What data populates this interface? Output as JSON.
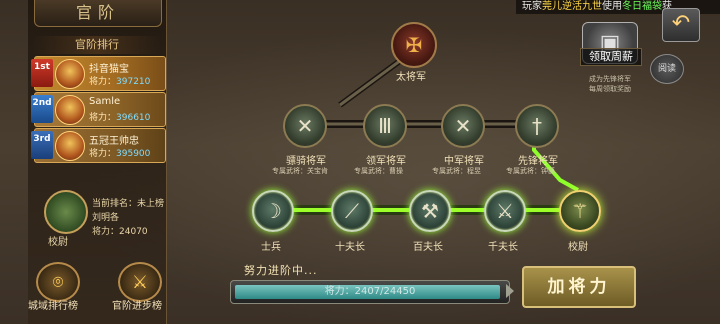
{
  "title": "官阶",
  "ticker": {
    "prefix": "玩家",
    "player": "莞儿逆活九世",
    "mid": "使用",
    "item": "冬日福袋",
    "suffix": "获"
  },
  "ranking": {
    "header": "官阶排行",
    "power_label": "将力：",
    "rows": [
      {
        "badge": "1st",
        "name": "抖音猫宝",
        "power": "397210"
      },
      {
        "badge": "2nd",
        "name": "Samle",
        "power": "396610"
      },
      {
        "badge": "3rd",
        "name": "五冠王帅忠",
        "power": "395900"
      }
    ]
  },
  "me": {
    "rank_label": "当前排名：",
    "rank_value": "未上榜",
    "name": "刘明各",
    "power_label": "将力：",
    "power": "24070",
    "title": "校尉"
  },
  "bottom_buttons": {
    "city_rank": "城域排行榜",
    "rank_progress": "官阶进步榜"
  },
  "reward": {
    "label": "领取周薪",
    "desc_line1": "成为先锋将军",
    "desc_line2": "每周领取奖励"
  },
  "read_label": "阅读",
  "tree": {
    "top": {
      "name": "太将军"
    },
    "generals": [
      {
        "name": "骠骑将军",
        "sub": "专属武将：关宝肯"
      },
      {
        "name": "领军将军",
        "sub": "专属武将：曹操"
      },
      {
        "name": "中军将军",
        "sub": "专属武将：程昱"
      },
      {
        "name": "先锋将军",
        "sub": "专属武将：钟繇"
      }
    ],
    "soldiers": [
      {
        "name": "士兵"
      },
      {
        "name": "十夫长"
      },
      {
        "name": "百夫长"
      },
      {
        "name": "千夫长"
      },
      {
        "name": "校尉"
      }
    ]
  },
  "progress": {
    "title": "努力进阶中...",
    "label": "将力：2407/24450",
    "fraction": 0.98
  },
  "add_button": "加将力"
}
